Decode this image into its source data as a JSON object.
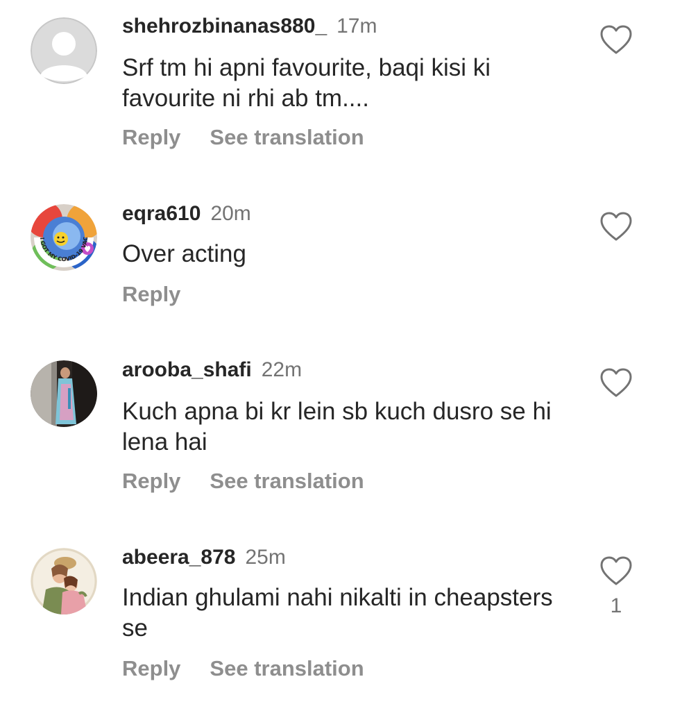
{
  "comments": [
    {
      "username": "shehrozbinanas880_",
      "time": "17m",
      "text": "Srf tm hi apni favourite, baqi kisi ki favourite ni rhi ab tm....",
      "reply_label": "Reply",
      "translate_label": "See translation",
      "avatar": "default-avatar-icon"
    },
    {
      "username": "eqra610",
      "time": "20m",
      "text": "Over acting",
      "reply_label": "Reply",
      "avatar": "covid-vaccine-sticker-avatar",
      "avatar_text": "I GOT MY COVID-19 VACCINE"
    },
    {
      "username": "arooba_shafi",
      "time": "22m",
      "text": "Kuch apna bi kr lein sb kuch dusro se hi lena hai",
      "reply_label": "Reply",
      "translate_label": "See translation",
      "avatar": "photo-avatar"
    },
    {
      "username": "abeera_878",
      "time": "25m",
      "text": "Indian ghulami nahi nikalti in cheapsters se",
      "reply_label": "Reply",
      "translate_label": "See translation",
      "like_count": "1",
      "avatar": "illustration-avatar"
    }
  ],
  "icons": {
    "like": "heart-outline-icon"
  },
  "colors": {
    "text": "#262626",
    "secondary": "#737373",
    "action": "#8e8e8e"
  }
}
